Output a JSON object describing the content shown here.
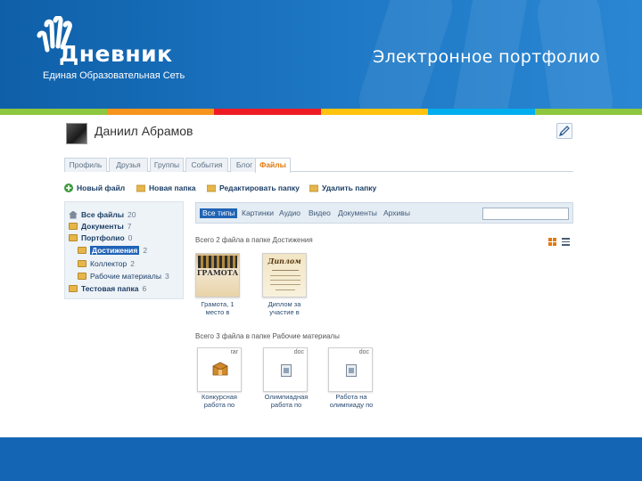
{
  "slide": {
    "title": "Электронное портфолио",
    "logo_text": "Дневник",
    "logo_subtitle": "Единая Образовательная Сеть",
    "stripe_colors": [
      "#8dc63f",
      "#f7941d",
      "#ed1c24",
      "#ffc20e",
      "#00aeef",
      "#8dc63f"
    ]
  },
  "profile": {
    "user_name": "Даниил Абрамов"
  },
  "tabs": [
    {
      "label": "Профиль",
      "active": false
    },
    {
      "label": "Друзья",
      "active": false
    },
    {
      "label": "Группы",
      "active": false
    },
    {
      "label": "События",
      "active": false
    },
    {
      "label": "Блог",
      "active": false
    },
    {
      "label": "Файлы",
      "active": true
    }
  ],
  "toolbar": {
    "new_file": "Новый файл",
    "new_folder": "Новая папка",
    "edit_folder": "Редактировать папку",
    "delete_folder": "Удалить папку"
  },
  "folders": {
    "all_files": {
      "label": "Все файлы",
      "count": "20"
    },
    "documents": {
      "label": "Документы",
      "count": "7"
    },
    "portfolio": {
      "label": "Портфолио",
      "count": "0"
    },
    "achievements": {
      "label": "Достижения",
      "count": "2"
    },
    "collector": {
      "label": "Коллектор",
      "count": "2"
    },
    "work_materials": {
      "label": "Рабочие материалы",
      "count": "3"
    },
    "test_folder": {
      "label": "Тестовая папка",
      "count": "6"
    }
  },
  "filters": [
    "Все типы",
    "Картинки",
    "Аудио",
    "Видео",
    "Документы",
    "Архивы"
  ],
  "sections": {
    "achievements_caption": "Всего 2 файла в папке Достижения",
    "materials_caption": "Всего 3 файла в папке Рабочие материалы"
  },
  "files_achievements": [
    {
      "caption1": "Грамота, 1",
      "caption2": "место в",
      "thumb_word": "ГРАМОТА"
    },
    {
      "caption1": "Диплом за",
      "caption2": "участие в",
      "thumb_word": "Диплом"
    }
  ],
  "files_materials": [
    {
      "ext": "rar",
      "caption1": "Конкурсная",
      "caption2": "работа по"
    },
    {
      "ext": "doc",
      "caption1": "Олимпиадная",
      "caption2": "работа по"
    },
    {
      "ext": "doc",
      "caption1": "Работа на",
      "caption2": "олимпиаду по"
    }
  ],
  "colors": {
    "header_blue": "#1466b5",
    "accent_orange": "#e07a12",
    "link_blue": "#1d3f66",
    "selection_blue": "#1f63b5"
  }
}
